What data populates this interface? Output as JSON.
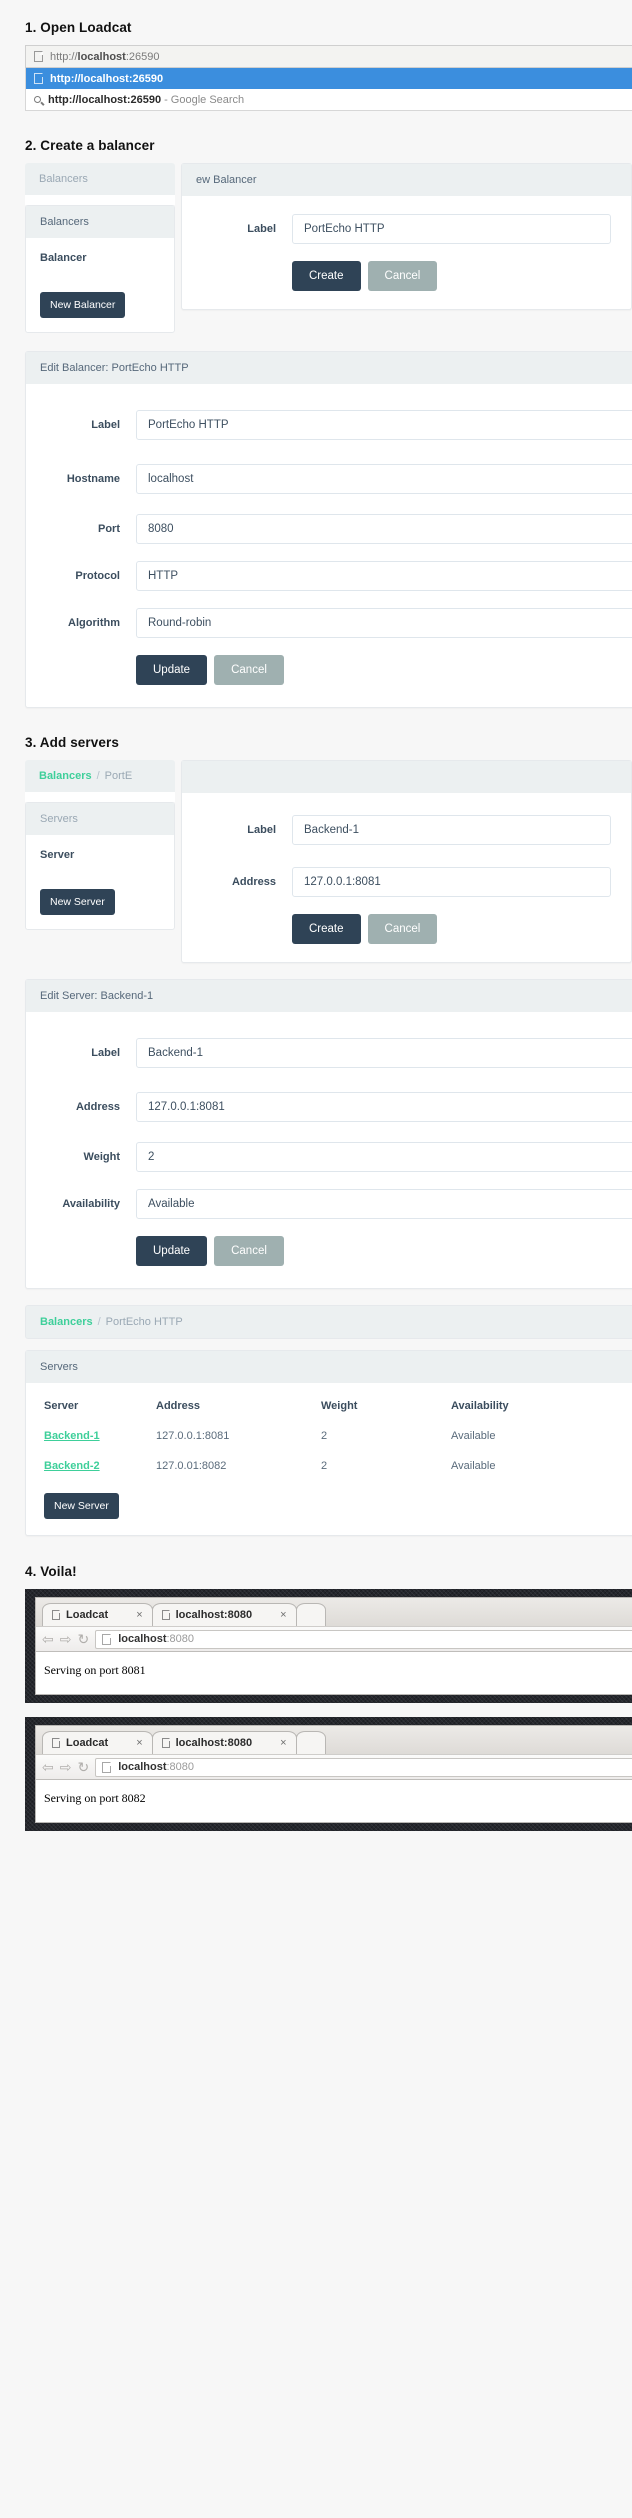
{
  "steps": {
    "one": "1. Open Loadcat",
    "two": "2. Create a balancer",
    "three": "3. Add servers",
    "four": "4. Voila!"
  },
  "omnibox": {
    "typed_scheme": "http://",
    "typed_host": "localhost",
    "typed_port": ":26590",
    "suggestion_url": "http://localhost:26590",
    "suggestion_search": "http://localhost:26590",
    "suggestion_search_suffix": "- Google Search"
  },
  "new_balancer": {
    "sidebar_head_ghost": "Balancers",
    "sidebar_head": "Balancers",
    "sidebar_label": "Balancer",
    "new_button": "New Balancer",
    "panel_title": "ew Balancer",
    "label_field": "Label",
    "label_value": "PortEcho HTTP",
    "create": "Create",
    "cancel": "Cancel"
  },
  "edit_balancer": {
    "panel_title": "Edit Balancer: PortEcho HTTP",
    "fields": [
      {
        "label": "Label",
        "value": "PortEcho HTTP",
        "type": "text"
      },
      {
        "label": "Hostname",
        "value": "localhost",
        "type": "text"
      },
      {
        "label": "Port",
        "value": "8080",
        "type": "text"
      },
      {
        "label": "Protocol",
        "value": "HTTP",
        "type": "select"
      },
      {
        "label": "Algorithm",
        "value": "Round-robin",
        "type": "select"
      }
    ],
    "update": "Update",
    "cancel": "Cancel"
  },
  "new_server": {
    "breadcrumb_link": "Balancers",
    "breadcrumb_sep": "/",
    "breadcrumb_current": "PortE",
    "sidebar_head": "Servers",
    "sidebar_label": "Server",
    "new_button": "New Server",
    "fields": [
      {
        "label": "Label",
        "value": "Backend-1"
      },
      {
        "label": "Address",
        "value": "127.0.0.1:8081"
      }
    ],
    "create": "Create",
    "cancel": "Cancel"
  },
  "edit_server": {
    "panel_title": "Edit Server: Backend-1",
    "fields": [
      {
        "label": "Label",
        "value": "Backend-1",
        "type": "text"
      },
      {
        "label": "Address",
        "value": "127.0.0.1:8081",
        "type": "text"
      },
      {
        "label": "Weight",
        "value": "2",
        "type": "text"
      },
      {
        "label": "Availability",
        "value": "Available",
        "type": "select"
      }
    ],
    "update": "Update",
    "cancel": "Cancel"
  },
  "servers_list": {
    "breadcrumb_link": "Balancers",
    "breadcrumb_sep": "/",
    "breadcrumb_current": "PortEcho HTTP",
    "panel_title": "Servers",
    "columns": [
      "Server",
      "Address",
      "Weight",
      "Availability"
    ],
    "rows": [
      {
        "server": "Backend-1",
        "address": "127.0.0.1:8081",
        "weight": "2",
        "availability": "Available"
      },
      {
        "server": "Backend-2",
        "address": "127.0.01:8082",
        "weight": "2",
        "availability": "Available"
      }
    ],
    "new_button": "New Server"
  },
  "browsers": [
    {
      "tab1": "Loadcat",
      "tab1_close": "×",
      "tab2_host": "localhost",
      "tab2_port": ":8080",
      "tab2_close": "×",
      "url_host": "localhost",
      "url_port": ":8080",
      "body": "Serving on port 8081",
      "back": "⇦",
      "forward": "⇨",
      "reload": "↻"
    },
    {
      "tab1": "Loadcat",
      "tab1_close": "×",
      "tab2_host": "localhost",
      "tab2_port": ":8080",
      "tab2_close": "×",
      "url_host": "localhost",
      "url_port": ":8080",
      "body": "Serving on port 8082",
      "back": "⇦",
      "forward": "⇨",
      "reload": "↻"
    }
  ],
  "colors": {
    "accent_green": "#3ecf9a",
    "dark_button": "#2f4356",
    "grey_button": "#9fb0b0",
    "panel_head": "#ecf0f1",
    "omni_select": "#3b8ede"
  }
}
